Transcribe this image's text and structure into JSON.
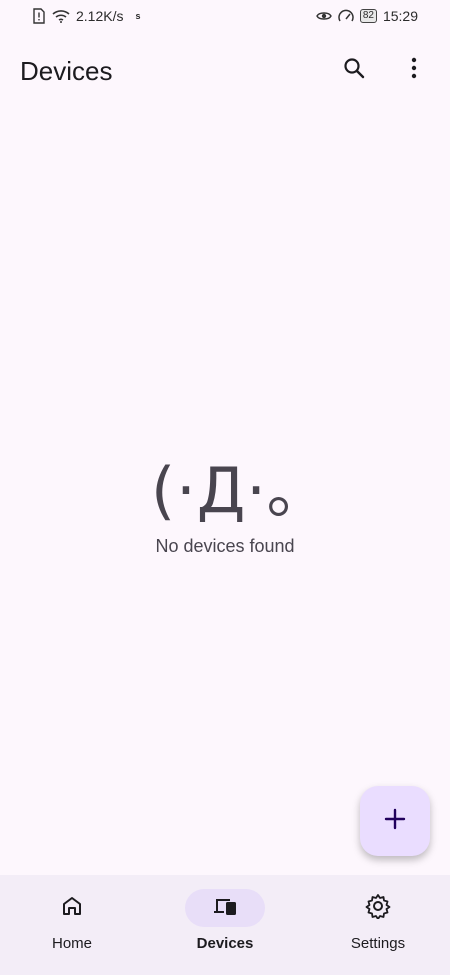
{
  "status_bar": {
    "left_icons": [
      "sim-alert-icon",
      "wifi-icon"
    ],
    "speed": "2.12K/s",
    "s_indicator": "s",
    "right_icons": [
      "eye-icon",
      "speedometer-icon"
    ],
    "battery": "82",
    "time": "15:29"
  },
  "app_bar": {
    "title": "Devices",
    "actions": [
      "search-icon",
      "more-vert-icon"
    ]
  },
  "empty_state": {
    "kaomoji": "(·Д·｡",
    "message": "No devices found"
  },
  "fab": {
    "icon": "add-icon"
  },
  "bottom_nav": {
    "items": [
      {
        "label": "Home",
        "icon": "home-icon",
        "active": false
      },
      {
        "label": "Devices",
        "icon": "devices-icon",
        "active": true
      },
      {
        "label": "Settings",
        "icon": "settings-icon",
        "active": false
      }
    ]
  },
  "colors": {
    "background": "#fdf7fd",
    "fab": "#eaddff",
    "navbar": "#f3edf7",
    "active_pill": "#e8def8",
    "text_secondary": "#49454f"
  }
}
